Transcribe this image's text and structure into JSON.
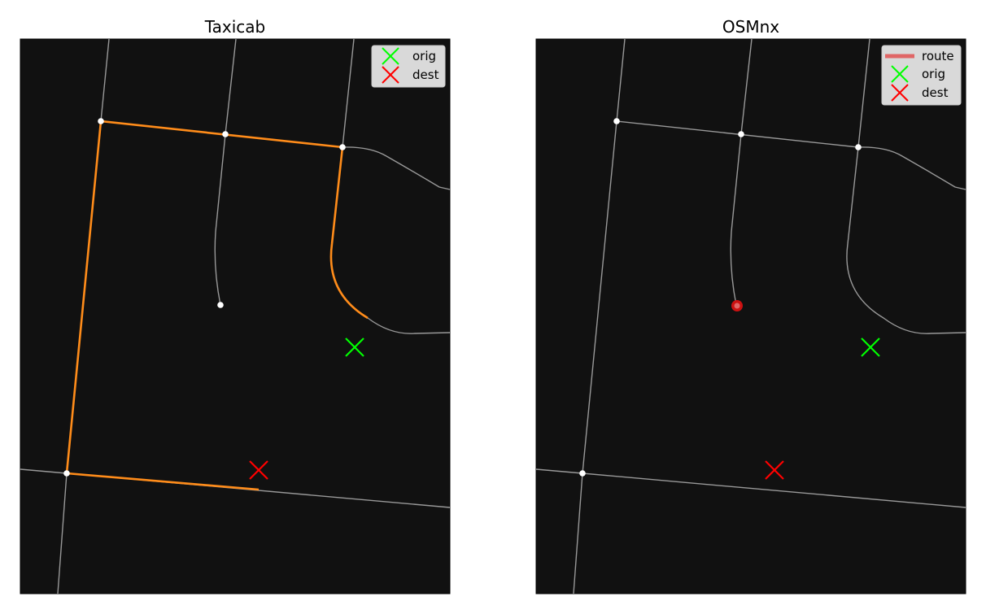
{
  "colors": {
    "background": "#111111",
    "street": "#999999",
    "node": "#ffffff",
    "taxicab_route": "#ff8c1a",
    "osmnx_route": "#e06666",
    "orig_marker": "#00ff00",
    "dest_marker": "#ff0000",
    "legend_bg": "#d9d9d9"
  },
  "chart_data": [
    {
      "type": "map",
      "title": "Taxicab",
      "legend": {
        "placement": "top-right",
        "entries": [
          {
            "label": "orig",
            "marker": "x",
            "color": "#00ff00"
          },
          {
            "label": "dest",
            "marker": "x",
            "color": "#ff0000"
          }
        ]
      },
      "route_color": "#ff8c1a",
      "origin_marker": "x",
      "destination_marker": "x"
    },
    {
      "type": "map",
      "title": "OSMnx",
      "legend": {
        "placement": "top-right",
        "entries": [
          {
            "label": "route",
            "marker": "line",
            "color": "#e06666"
          },
          {
            "label": "orig",
            "marker": "x",
            "color": "#00ff00"
          },
          {
            "label": "dest",
            "marker": "x",
            "color": "#ff0000"
          }
        ]
      },
      "route_color": "#e06666",
      "route_description": "single node (zero-length route)"
    }
  ]
}
